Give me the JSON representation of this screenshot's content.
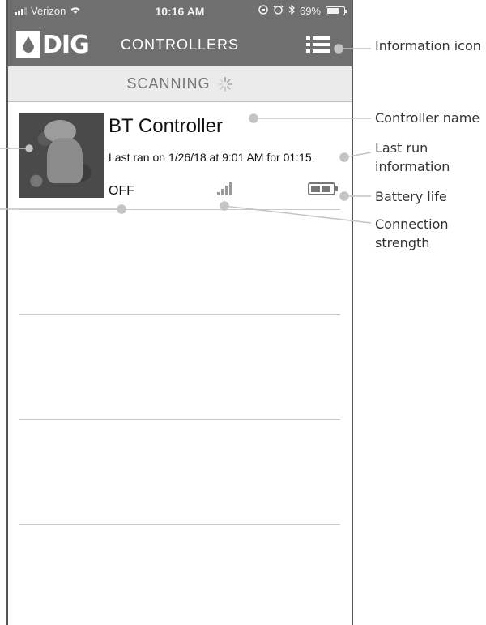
{
  "status_bar": {
    "carrier": "Verizon",
    "time": "10:16 AM",
    "battery_percent": "69%",
    "battery_level": 0.69
  },
  "nav": {
    "logo_text": "DIG",
    "title": "CONTROLLERS"
  },
  "scan": {
    "label": "SCANNING"
  },
  "controller": {
    "name": "BT Controller",
    "last_run": "Last ran on 1/26/18 at 9:01 AM for 01:15.",
    "status": "OFF",
    "signal_bars": 4,
    "battery_cells": 2
  },
  "annotations": {
    "info_icon": "Information icon",
    "controller_name": "Controller name",
    "last_run_1": "Last run",
    "last_run_2": "information",
    "battery_life": "Battery life",
    "connection_1": "Connection",
    "connection_2": "strength"
  },
  "colors": {
    "bar_gray": "#6f6f6f",
    "scan_bg": "#ebebeb"
  }
}
